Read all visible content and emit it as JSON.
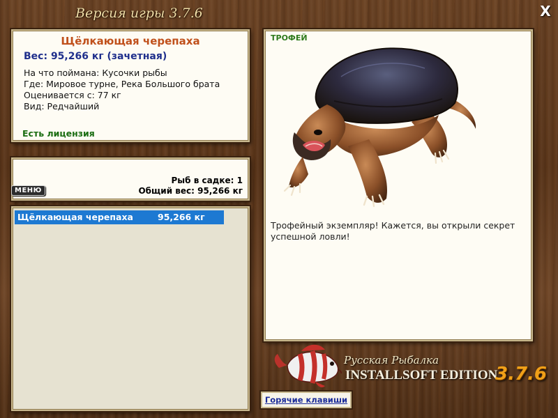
{
  "window": {
    "version_label": "Версия игры 3.7.6",
    "close_label": "X"
  },
  "catch": {
    "name": "Щёлкающая черепаха",
    "weight": "Вес: 95,266 кг (зачетная)",
    "bait": "На что поймана: Кусочки рыбы",
    "location": "Где: Мировое турне, Река Большого брата",
    "price": "Оценивается с: 77 кг",
    "rarity": "Вид: Редчайший",
    "license": "Есть лицензия"
  },
  "summary": {
    "menu_label": "МЕНЮ",
    "fish_count": "Рыб в садке: 1",
    "total_weight": "Общий вес: 95,266 кг"
  },
  "keepnet": {
    "items": [
      {
        "name": "Щёлкающая черепаха",
        "weight": "95,266 кг"
      }
    ]
  },
  "trophy": {
    "label": "ТРОФЕЙ",
    "description": "Трофейный экземпляр! Кажется, вы открыли секрет успешной ловли!"
  },
  "branding": {
    "title": "Русская Рыбалка",
    "edition": "INSTALLSOFT EDITION",
    "version": "3.7.6"
  },
  "footer": {
    "hotkeys_label": "Горячие клавиши"
  },
  "colors": {
    "accent_orange": "#c0501b",
    "accent_blue": "#1f2f8c",
    "license_green": "#1a6d12",
    "selection_blue": "#1d79d2",
    "version_gold": "#f0a018"
  }
}
